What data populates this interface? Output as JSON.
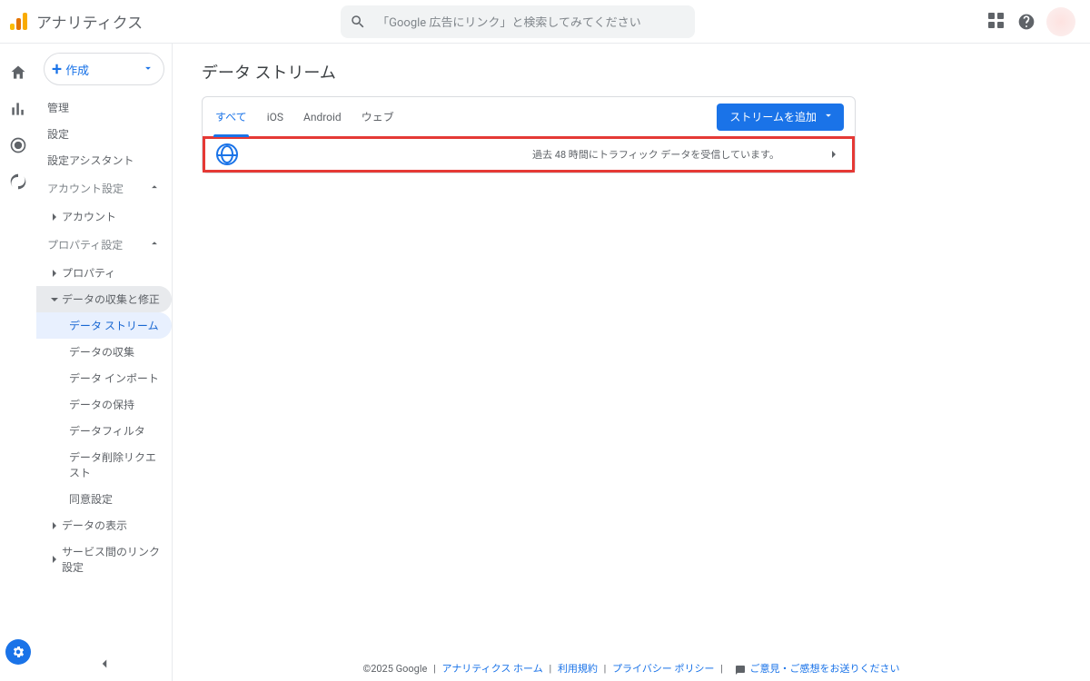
{
  "header": {
    "product_name": "アナリティクス",
    "search_placeholder": "「Google 広告にリンク」と検索してみてください"
  },
  "sidebar": {
    "create_label": "作成",
    "top": {
      "admin": "管理",
      "settings": "設定",
      "assistant": "設定アシスタント"
    },
    "account_section": {
      "header": "アカウント設定",
      "account": "アカウント"
    },
    "property_section": {
      "header": "プロパティ設定",
      "property": "プロパティ",
      "data_collect_fix": "データの収集と修正",
      "children": {
        "data_streams": "データ ストリーム",
        "data_collection": "データの収集",
        "data_import": "データ インポート",
        "data_retention": "データの保持",
        "data_filter": "データフィルタ",
        "delete_request": "データ削除リクエスト",
        "consent_settings": "同意設定"
      },
      "data_display": "データの表示",
      "service_links": "サービス間のリンク設定"
    }
  },
  "main": {
    "page_title": "データ ストリーム",
    "tabs": {
      "all": "すべて",
      "ios": "iOS",
      "android": "Android",
      "web": "ウェブ"
    },
    "add_stream_label": "ストリームを追加",
    "row_status": "過去 48 時間にトラフィック データを受信しています。"
  },
  "footer": {
    "copyright": "©2025 Google",
    "home": "アナリティクス ホーム",
    "tos": "利用規約",
    "privacy": "プライバシー ポリシー",
    "feedback": "ご意見・ご感想をお送りください"
  }
}
